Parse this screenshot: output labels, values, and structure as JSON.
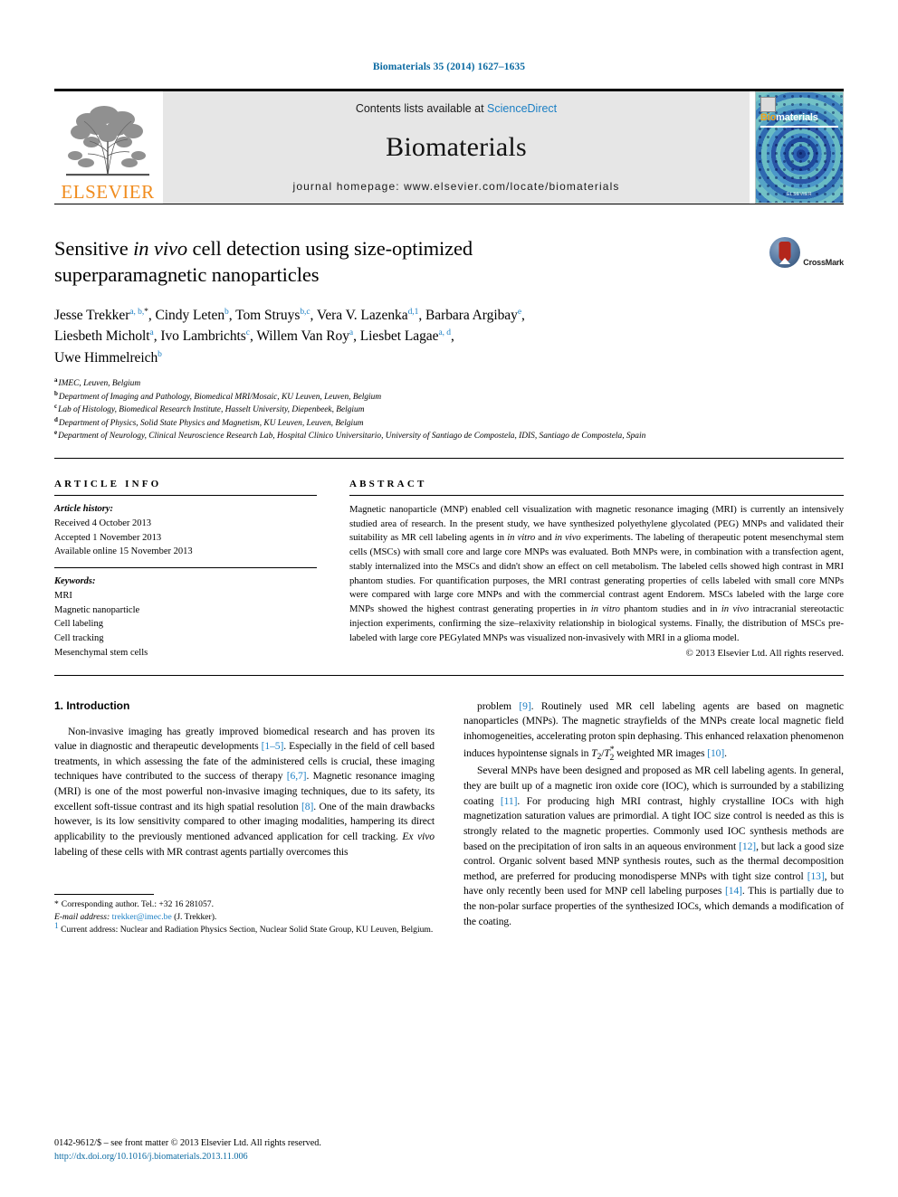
{
  "running_head": "Biomaterials 35 (2014) 1627–1635",
  "masthead": {
    "contents_prefix": "Contents lists available at ",
    "sciencedirect": "ScienceDirect",
    "journal_name": "Biomaterials",
    "homepage": "journal homepage: www.elsevier.com/locate/biomaterials",
    "publisher_logo_text": "ELSEVIER",
    "cover": {
      "title_bio": "Bio",
      "title_materials": "materials",
      "footer": "ELSEVIER"
    }
  },
  "article": {
    "title_line1_a": "Sensitive ",
    "title_line1_em": "in vivo",
    "title_line1_b": " cell detection using size-optimized",
    "title_line2": "superparamagnetic nanoparticles",
    "crossmark_label": "CrossMark",
    "authors": [
      {
        "name": "Jesse Trekker",
        "sup": "a, b,",
        "star": "*",
        "sep": ", "
      },
      {
        "name": "Cindy Leten",
        "sup": "b",
        "star": "",
        "sep": ", "
      },
      {
        "name": "Tom Struys",
        "sup": "b,c",
        "star": "",
        "sep": ", "
      },
      {
        "name": "Vera V. Lazenka",
        "sup": "d,1",
        "star": "",
        "sep": ", "
      },
      {
        "name": "Barbara Argibay",
        "sup": "e",
        "star": "",
        "sep": ","
      },
      {
        "name": "Liesbeth Micholt",
        "sup": "a",
        "star": "",
        "sep": ", "
      },
      {
        "name": "Ivo Lambrichts",
        "sup": "c",
        "star": "",
        "sep": ", "
      },
      {
        "name": "Willem Van Roy",
        "sup": "a",
        "star": "",
        "sep": ", "
      },
      {
        "name": "Liesbet Lagae",
        "sup": "a, d",
        "star": "",
        "sep": ","
      },
      {
        "name": "Uwe Himmelreich",
        "sup": "b",
        "star": "",
        "sep": ""
      }
    ],
    "affiliations": [
      {
        "mark": "a",
        "text": "IMEC, Leuven, Belgium"
      },
      {
        "mark": "b",
        "text": "Department of Imaging and Pathology, Biomedical MRI/Mosaic, KU Leuven, Leuven, Belgium"
      },
      {
        "mark": "c",
        "text": "Lab of Histology, Biomedical Research Institute, Hasselt University, Diepenbeek, Belgium"
      },
      {
        "mark": "d",
        "text": "Department of Physics, Solid State Physics and Magnetism, KU Leuven, Leuven, Belgium"
      },
      {
        "mark": "e",
        "text": "Department of Neurology, Clinical Neuroscience Research Lab, Hospital Clinico Universitario, University of Santiago de Compostela, IDIS, Santiago de Compostela, Spain"
      }
    ]
  },
  "article_info": {
    "heading": "ARTICLE INFO",
    "history_label": "Article history:",
    "history": [
      "Received 4 October 2013",
      "Accepted 1 November 2013",
      "Available online 15 November 2013"
    ],
    "keywords_label": "Keywords:",
    "keywords": [
      "MRI",
      "Magnetic nanoparticle",
      "Cell labeling",
      "Cell tracking",
      "Mesenchymal stem cells"
    ]
  },
  "abstract": {
    "heading": "ABSTRACT",
    "p1_a": "Magnetic nanoparticle (MNP) enabled cell visualization with magnetic resonance imaging (MRI) is currently an intensively studied area of research. In the present study, we have synthesized polyethylene glycolated (PEG) MNPs and validated their suitability as MR cell labeling agents in ",
    "p1_em1": "in vitro",
    "p1_b": " and ",
    "p1_em2": "in vivo",
    "p1_c": " experiments. The labeling of therapeutic potent mesenchymal stem cells (MSCs) with small core and large core MNPs was evaluated. Both MNPs were, in combination with a transfection agent, stably internalized into the MSCs and didn't show an effect on cell metabolism. The labeled cells showed high contrast in MRI phantom studies. For quantification purposes, the MRI contrast generating properties of cells labeled with small core MNPs were compared with large core MNPs and with the commercial contrast agent Endorem. MSCs labeled with the large core MNPs showed the highest contrast generating properties in ",
    "p1_em3": "in vitro",
    "p1_d": " phantom studies and in ",
    "p1_em4": "in vivo",
    "p1_e": " intracranial stereotactic injection experiments, confirming the size–relaxivity relationship in biological systems. Finally, the distribution of MSCs pre-labeled with large core PEGylated MNPs was visualized non-invasively with MRI in a glioma model.",
    "copyright": "© 2013 Elsevier Ltd. All rights reserved."
  },
  "introduction": {
    "heading": "1. Introduction",
    "left_p1_a": "Non-invasive imaging has greatly improved biomedical research and has proven its value in diagnostic and therapeutic developments ",
    "left_p1_c1": "[1–5]",
    "left_p1_b": ". Especially in the field of cell based treatments, in which assessing the fate of the administered cells is crucial, these imaging techniques have contributed to the success of therapy ",
    "left_p1_c2": "[6,7]",
    "left_p1_c": ". Magnetic resonance imaging (MRI) is one of the most powerful non-invasive imaging techniques, due to its safety, its excellent soft-tissue contrast and its high spatial resolution ",
    "left_p1_c3": "[8]",
    "left_p1_d": ". One of the main drawbacks however, is its low sensitivity compared to other imaging modalities, hampering its direct applicability to the previously mentioned advanced application for cell tracking. ",
    "left_p1_em": "Ex vivo",
    "left_p1_e": " labeling of these cells with MR contrast agents partially overcomes this",
    "right_p1_a": "problem ",
    "right_p1_c1": "[9]",
    "right_p1_b": ". Routinely used MR cell labeling agents are based on magnetic nanoparticles (MNPs). The magnetic strayfields of the MNPs create local magnetic field inhomogeneities, accelerating proton spin dephasing. This enhanced relaxation phenomenon induces hypointense signals in ",
    "right_p1_t2": "T",
    "right_p1_t2sub": "2",
    "right_p1_slash": "/",
    "right_p1_t2star": "T",
    "right_p1_t2starsub": "2",
    "right_p1_t2starsup": "*",
    "right_p1_c": " weighted MR images ",
    "right_p1_c2": "[10]",
    "right_p1_d": ".",
    "right_p2_a": "Several MNPs have been designed and proposed as MR cell labeling agents. In general, they are built up of a magnetic iron oxide core (IOC), which is surrounded by a stabilizing coating ",
    "right_p2_c1": "[11]",
    "right_p2_b": ". For producing high MRI contrast, highly crystalline IOCs with high magnetization saturation values are primordial. A tight IOC size control is needed as this is strongly related to the magnetic properties. Commonly used IOC synthesis methods are based on the precipitation of iron salts in an aqueous environment ",
    "right_p2_c2": "[12]",
    "right_p2_c": ", but lack a good size control. Organic solvent based MNP synthesis routes, such as the thermal decomposition method, are preferred for producing monodisperse MNPs with tight size control ",
    "right_p2_c3": "[13]",
    "right_p2_d": ", but have only recently been used for MNP cell labeling purposes ",
    "right_p2_c4": "[14]",
    "right_p2_e": ". This is partially due to the non-polar surface properties of the synthesized IOCs, which demands a modification of the coating."
  },
  "footnotes": {
    "corresponding_mark": "*",
    "corresponding": "Corresponding author. Tel.: +32 16 281057.",
    "email_label": "E-mail address:",
    "email": "trekker@imec.be",
    "email_owner": "(J. Trekker).",
    "current_mark": "1",
    "current_address": "Current address: Nuclear and Radiation Physics Section, Nuclear Solid State Group, KU Leuven, Belgium."
  },
  "page_footer": {
    "issn_line": "0142-9612/$ – see front matter © 2013 Elsevier Ltd. All rights reserved.",
    "doi": "http://dx.doi.org/10.1016/j.biomaterials.2013.11.006"
  }
}
